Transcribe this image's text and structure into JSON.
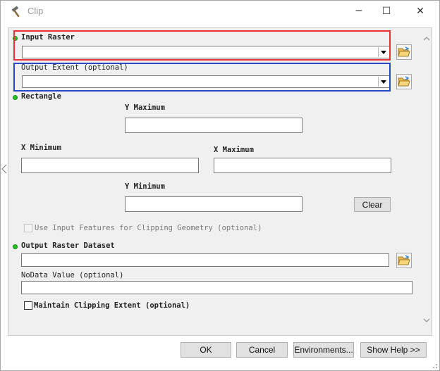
{
  "window": {
    "title": "Clip",
    "icons": {
      "app": "hammer-icon",
      "minimize": "minimize-icon",
      "maximize": "maximize-icon",
      "close": "close-icon"
    },
    "min_glyph": "─",
    "max_glyph": "☐",
    "close_glyph": "✕"
  },
  "form": {
    "input_raster": {
      "label": "Input Raster",
      "value": ""
    },
    "output_extent": {
      "label": "Output Extent (optional)",
      "value": ""
    },
    "rectangle": {
      "label": "Rectangle",
      "y_max_label": "Y Maximum",
      "y_max": "",
      "x_min_label": "X Minimum",
      "x_min": "",
      "x_max_label": "X Maximum",
      "x_max": "",
      "y_min_label": "Y Minimum",
      "y_min": "",
      "clear_label": "Clear"
    },
    "use_input_features": {
      "label": "Use Input Features for Clipping Geometry (optional)",
      "checked": false,
      "enabled": false
    },
    "output_raster": {
      "label": "Output Raster Dataset",
      "value": ""
    },
    "nodata": {
      "label": "NoData Value (optional)",
      "value": ""
    },
    "maintain_extent": {
      "label": "Maintain Clipping Extent (optional)",
      "checked": false
    }
  },
  "footer": {
    "ok": "OK",
    "cancel": "Cancel",
    "environments": "Environments...",
    "show_help": "Show Help >>"
  },
  "colors": {
    "required_dot": "#22c322",
    "highlight_red": "#e8303a",
    "highlight_blue": "#2a46c8",
    "panel_bg": "#f0f0f0"
  }
}
